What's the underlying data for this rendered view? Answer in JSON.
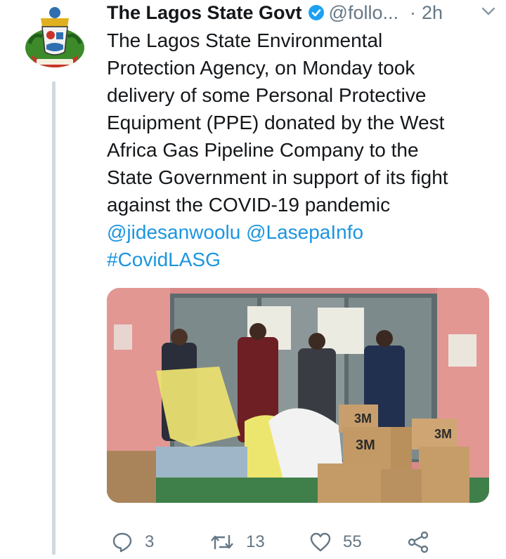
{
  "tweet": {
    "author_name": "The Lagos State Govt",
    "handle": "@follo...",
    "separator": "·",
    "time": "2h",
    "text_lines": [
      "The Lagos State Environmental",
      "Protection Agency, on Monday took",
      "delivery of some Personal Protective",
      "Equipment (PPE) donated by the West",
      "Africa Gas Pipeline Company to the",
      "State Government in support of its fight",
      "against the COVID-19 pandemic"
    ],
    "mention_1": "@jidesanwoolu",
    "mention_2": "@LasepaInfo",
    "hashtag": "#CovidLASG"
  },
  "actions": {
    "replies": "3",
    "retweets": "13",
    "likes": "55"
  },
  "colors": {
    "link": "#1b95e0",
    "muted": "#657786",
    "verified": "#1da1f2",
    "thread_line": "#cfd9de"
  },
  "media": {
    "box_labels": [
      "3M",
      "3M",
      "3M"
    ],
    "icons": [
      "avatar-seal",
      "verified-icon",
      "chevron-down-icon",
      "reply-icon",
      "retweet-icon",
      "like-icon",
      "share-icon"
    ]
  }
}
